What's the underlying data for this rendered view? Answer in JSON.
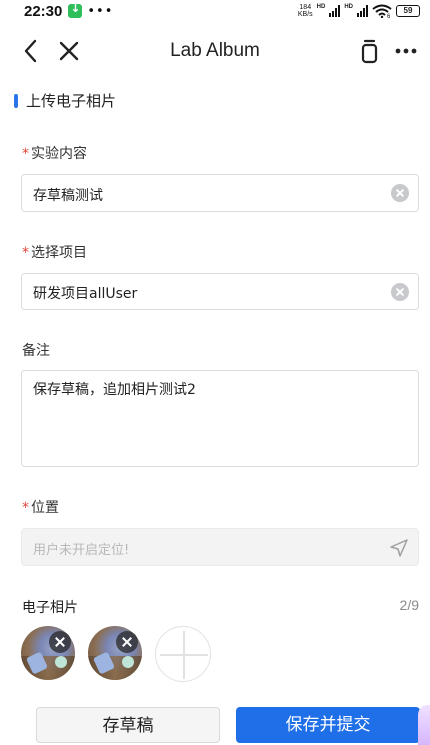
{
  "status_bar": {
    "time": "22:30",
    "net_speed_value": "184",
    "net_speed_unit": "KB/s",
    "hd1": "HD",
    "hd2": "HD",
    "wifi_label": "6",
    "battery": "59"
  },
  "navbar": {
    "title": "Lab Album",
    "icons": [
      "back-icon",
      "close-icon",
      "copy-icon",
      "more-icon"
    ]
  },
  "section": {
    "title": "上传电子相片"
  },
  "form": {
    "experiment": {
      "required_mark": "*",
      "label": "实验内容",
      "value": "存草稿测试"
    },
    "project": {
      "required_mark": "*",
      "label": "选择项目",
      "value": "研发项目allUser"
    },
    "remark": {
      "label": "备注",
      "value": "保存草稿，追加相片测试2"
    },
    "location": {
      "required_mark": "*",
      "label": "位置",
      "placeholder": "用户未开启定位!"
    },
    "photos": {
      "label": "电子相片",
      "count": "2/9"
    }
  },
  "buttons": {
    "draft": "存草稿",
    "submit": "保存并提交"
  },
  "colors": {
    "accent": "#1f6fe8",
    "required": "#e0453a"
  }
}
